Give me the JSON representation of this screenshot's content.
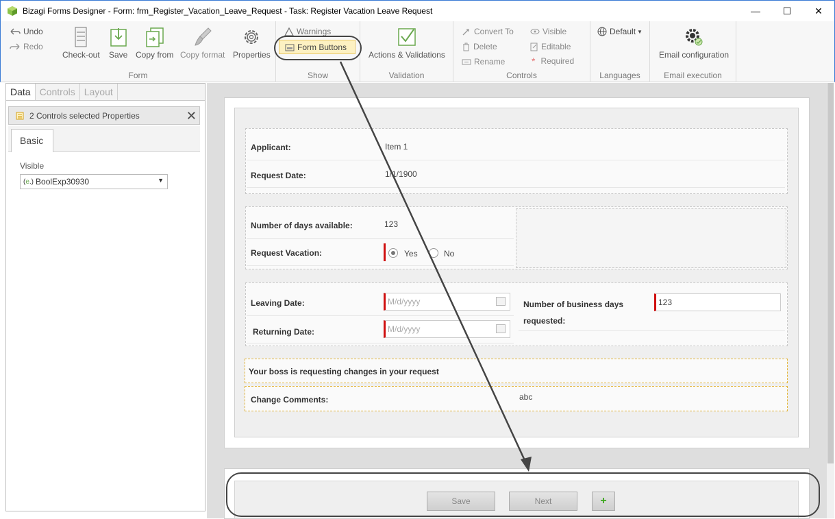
{
  "window": {
    "title": "Bizagi Forms Designer  - Form: frm_Register_Vacation_Leave_Request - Task:  Register Vacation Leave Request",
    "minimize": "—",
    "maximize": "☐",
    "close": "✕"
  },
  "ribbon": {
    "form": {
      "label": "Form",
      "undo": "Undo",
      "redo": "Redo",
      "checkout": "Check-out",
      "save": "Save",
      "copy_from": "Copy from",
      "copy_format": "Copy format",
      "properties": "Properties"
    },
    "show": {
      "label": "Show",
      "warnings": "Warnings",
      "form_buttons": "Form Buttons"
    },
    "validation": {
      "label": "Validation",
      "actions": "Actions & Validations"
    },
    "controls": {
      "label": "Controls",
      "convert_to": "Convert To",
      "delete": "Delete",
      "rename": "Rename",
      "visible": "Visible",
      "editable": "Editable",
      "required": "Required"
    },
    "languages": {
      "label": "Languages",
      "default": "Default"
    },
    "email": {
      "label": "Email execution",
      "config": "Email configuration"
    }
  },
  "left_panel": {
    "tabs": [
      "Data",
      "Controls",
      "Layout"
    ],
    "properties_title": "2 Controls selected Properties",
    "basic_tab": "Basic",
    "visible_label": "Visible",
    "visible_value": "BoolExp30930"
  },
  "form": {
    "applicant_label": "Applicant:",
    "applicant_value": "Item 1",
    "request_date_label": "Request Date:",
    "request_date_value": "1/1/1900",
    "days_available_label": "Number of days available:",
    "days_available_value": "123",
    "request_vacation_label": "Request Vacation:",
    "yes": "Yes",
    "no": "No",
    "leaving_date_label": "Leaving Date:",
    "leaving_date_placeholder": "M/d/yyyy",
    "returning_date_label": "Returning Date:",
    "returning_date_placeholder": "M/d/yyyy",
    "business_days_label_1": "Number of business days",
    "business_days_label_2": "requested:",
    "business_days_value": "123",
    "boss_message": "Your boss is requesting changes in your request",
    "change_comments_label": "Change Comments:",
    "change_comments_value": "abc"
  },
  "form_buttons": {
    "save": "Save",
    "next": "Next",
    "add": "+"
  }
}
